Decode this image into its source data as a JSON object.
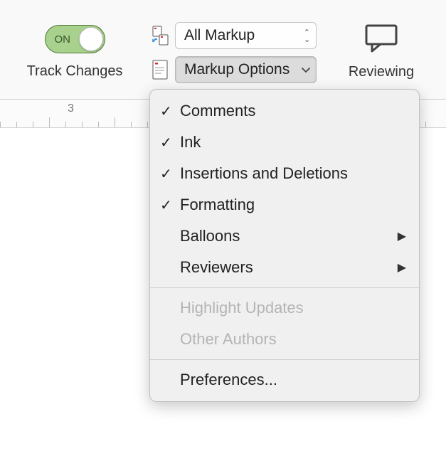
{
  "trackChanges": {
    "toggleText": "ON",
    "caption": "Track Changes",
    "state": true
  },
  "markup": {
    "displayDropdown": {
      "value": "All Markup"
    },
    "optionsButton": {
      "label": "Markup Options"
    }
  },
  "reviewing": {
    "caption": "Reviewing"
  },
  "ruler": {
    "numberVisible": "3"
  },
  "menu": {
    "items": [
      {
        "label": "Comments",
        "checked": true,
        "submenu": false,
        "disabled": false
      },
      {
        "label": "Ink",
        "checked": true,
        "submenu": false,
        "disabled": false
      },
      {
        "label": "Insertions and Deletions",
        "checked": true,
        "submenu": false,
        "disabled": false
      },
      {
        "label": "Formatting",
        "checked": true,
        "submenu": false,
        "disabled": false
      },
      {
        "label": "Balloons",
        "checked": false,
        "submenu": true,
        "disabled": false
      },
      {
        "label": "Reviewers",
        "checked": false,
        "submenu": true,
        "disabled": false
      }
    ],
    "disabledItems": [
      {
        "label": "Highlight Updates"
      },
      {
        "label": "Other Authors"
      }
    ],
    "preferences": {
      "label": "Preferences..."
    }
  }
}
